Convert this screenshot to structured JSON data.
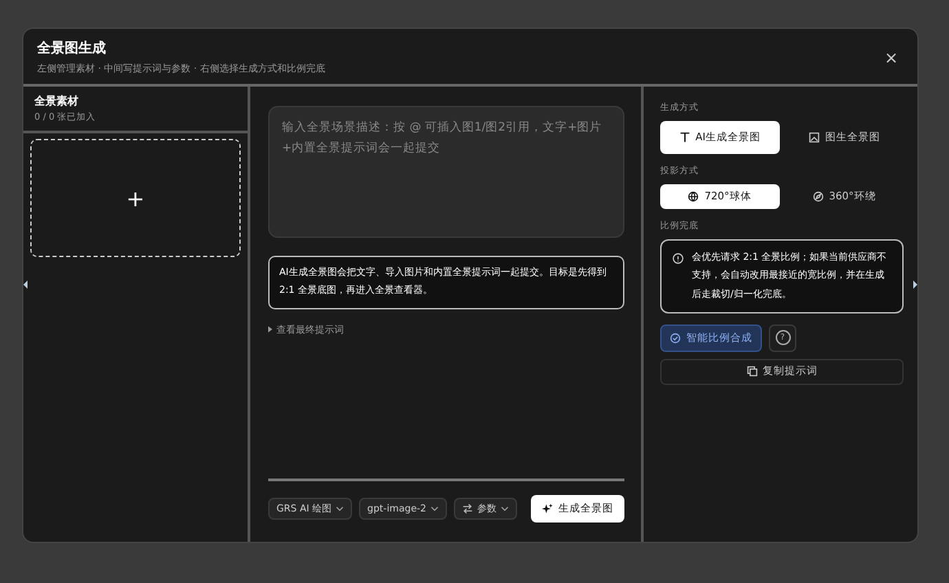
{
  "dialog": {
    "title": "全景图生成",
    "subtitle": "左侧管理素材 · 中间写提示词与参数 · 右侧选择生成方式和比例完底",
    "close": "×"
  },
  "assets": {
    "title": "全景素材",
    "count": "0 / 0 张已加入",
    "add": "+"
  },
  "prompt": {
    "placeholder": "输入全景场景描述：按 @ 可插入图1/图2引用，文字+图片+内置全景提示词会一起提交",
    "note": "AI生成全景图会把文字、导入图片和内置全景提示词一起提交。目标是先得到 2:1 全景底图，再进入全景查看器。",
    "toggle": "查看最终提示词",
    "expanded": false
  },
  "toolbar": [
    {
      "label": "GRS AI 绘图",
      "kind": "select"
    },
    {
      "label": "gpt-image-2",
      "kind": "select"
    },
    {
      "label": "参数",
      "kind": "params"
    }
  ],
  "generate_button": "生成全景图",
  "mode": {
    "label": "生成方式",
    "options": [
      {
        "label": "AI生成全景图",
        "kind": "text",
        "selected": true
      },
      {
        "label": "图生全景图",
        "kind": "image",
        "selected": false
      }
    ]
  },
  "projection": {
    "label": "投影方式",
    "options": [
      {
        "label": "720°球体",
        "kind": "globe",
        "selected": true
      },
      {
        "label": "360°环绕",
        "kind": "compass",
        "selected": false
      }
    ]
  },
  "ratio": {
    "label": "比例完底",
    "info": "会优先请求 2:1 全景比例；如果当前供应商不支持，会自动改用最接近的宽比例，并在生成后走裁切/归一化完底。",
    "smart_button": "智能比例合成",
    "smart_on": true,
    "help": "?"
  },
  "copy_button": "复制提示词"
}
